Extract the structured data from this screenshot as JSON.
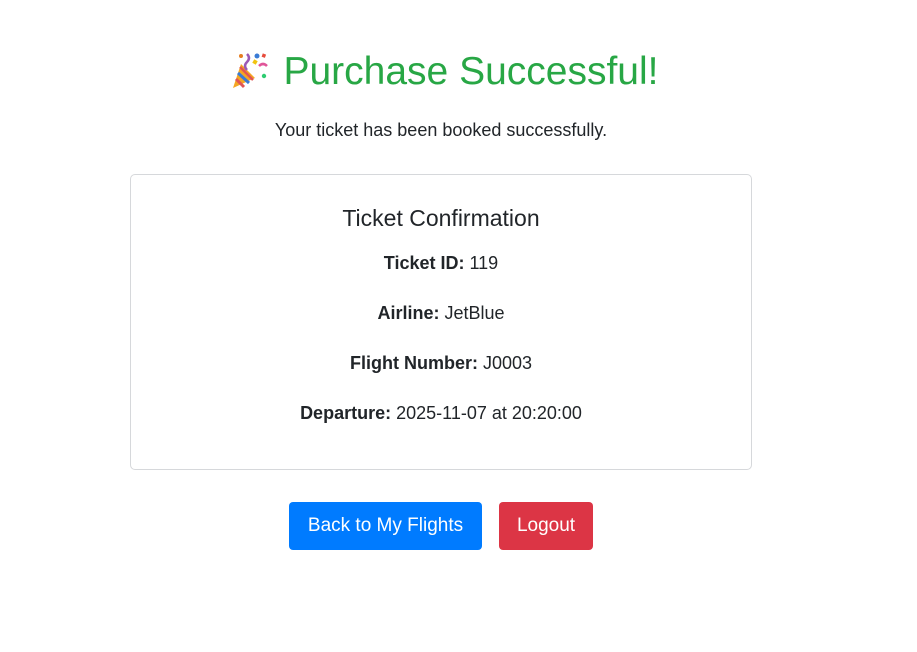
{
  "header": {
    "title": "Purchase Successful!",
    "icon": "party-popper-icon",
    "subtitle": "Your ticket has been booked successfully."
  },
  "card": {
    "title": "Ticket Confirmation",
    "fields": [
      {
        "label": "Ticket ID:",
        "value": "119"
      },
      {
        "label": "Airline:",
        "value": "JetBlue"
      },
      {
        "label": "Flight Number:",
        "value": "J0003"
      },
      {
        "label": "Departure:",
        "value": "2025-11-07 at 20:20:00"
      }
    ]
  },
  "actions": {
    "back_label": "Back to My Flights",
    "logout_label": "Logout"
  },
  "colors": {
    "success": "#28a745",
    "primary": "#007bff",
    "danger": "#dc3545"
  }
}
